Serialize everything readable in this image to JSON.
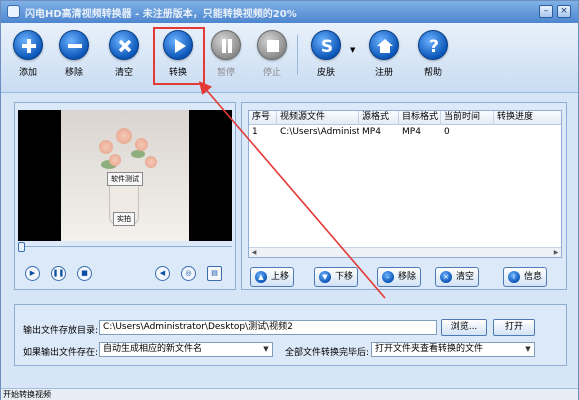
{
  "window": {
    "title": "闪电HD高清视频转换器 - 未注册版本，只能转换视频的20%"
  },
  "toolbar": {
    "add": "添加",
    "remove": "移除",
    "clear": "清空",
    "convert": "转换",
    "pause": "暂停",
    "stop": "停止",
    "skin": "皮肤",
    "register": "注册",
    "help": "帮助"
  },
  "preview": {
    "caption_top": "软件测试",
    "caption_bottom": "实拍"
  },
  "table": {
    "headers": [
      "序号",
      "视频源文件",
      "源格式",
      "目标格式",
      "当前时间",
      "转换进度"
    ],
    "rows": [
      {
        "index": "1",
        "source": "C:\\Users\\Administrator...",
        "src_format": "MP4",
        "dst_format": "MP4",
        "time": "0",
        "progress": ""
      }
    ]
  },
  "actions": {
    "up": "上移",
    "down": "下移",
    "remove": "移除",
    "clear": "清空",
    "info": "信息"
  },
  "output": {
    "dir_label": "输出文件存放目录:",
    "dir_value": "C:\\Users\\Administrator\\Desktop\\测试\\视频2",
    "browse": "浏览...",
    "open": "打开",
    "exists_label": "如果输出文件存在:",
    "exists_value": "自动生成相应的新文件名",
    "done_label": "全部文件转换完毕后:",
    "done_value": "打开文件夹查看转换的文件"
  },
  "status": {
    "text": "开始转换视频"
  },
  "colors": {
    "accent": "#0b56b8",
    "highlight": "#e53935",
    "panel": "#dce9f8"
  }
}
